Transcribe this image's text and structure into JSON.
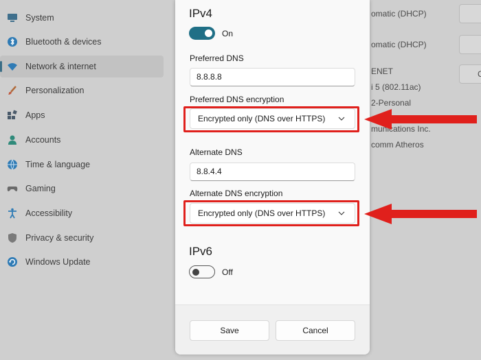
{
  "sidebar": {
    "items": [
      {
        "label": "System",
        "icon": "monitor-icon",
        "selected": false
      },
      {
        "label": "Bluetooth & devices",
        "icon": "bluetooth-icon",
        "selected": false
      },
      {
        "label": "Network & internet",
        "icon": "wifi-icon",
        "selected": true
      },
      {
        "label": "Personalization",
        "icon": "brush-icon",
        "selected": false
      },
      {
        "label": "Apps",
        "icon": "apps-icon",
        "selected": false
      },
      {
        "label": "Accounts",
        "icon": "person-icon",
        "selected": false
      },
      {
        "label": "Time & language",
        "icon": "globe-clock-icon",
        "selected": false
      },
      {
        "label": "Gaming",
        "icon": "gamepad-icon",
        "selected": false
      },
      {
        "label": "Accessibility",
        "icon": "accessibility-icon",
        "selected": false
      },
      {
        "label": "Privacy & security",
        "icon": "shield-icon",
        "selected": false
      },
      {
        "label": "Windows Update",
        "icon": "update-icon",
        "selected": false
      }
    ]
  },
  "background": {
    "lines": [
      "omatic (DHCP)",
      "omatic (DHCP)",
      "ENET",
      "i 5 (802.11ac)",
      "2-Personal",
      "munications Inc.",
      "comm Atheros"
    ],
    "button_fragment": "C"
  },
  "dialog": {
    "ipv4": {
      "title": "IPv4",
      "toggle_state": "On",
      "preferred_dns_label": "Preferred DNS",
      "preferred_dns_value": "8.8.8.8",
      "preferred_encryption_label": "Preferred DNS encryption",
      "preferred_encryption_value": "Encrypted only (DNS over HTTPS)",
      "alternate_dns_label": "Alternate DNS",
      "alternate_dns_value": "8.8.4.4",
      "alternate_encryption_label": "Alternate DNS encryption",
      "alternate_encryption_value": "Encrypted only (DNS over HTTPS)"
    },
    "ipv6": {
      "title": "IPv6",
      "toggle_state": "Off"
    },
    "save_label": "Save",
    "cancel_label": "Cancel"
  },
  "colors": {
    "accent": "#1f6f86",
    "annotation": "#e0201c"
  }
}
